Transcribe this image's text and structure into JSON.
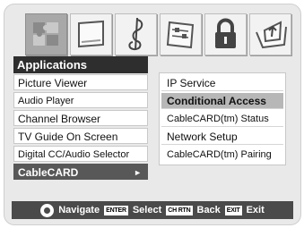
{
  "menu": {
    "title": "Applications",
    "items": [
      {
        "label": "Picture Viewer"
      },
      {
        "label": "Audio Player"
      },
      {
        "label": "Channel Browser"
      },
      {
        "label": "TV Guide On Screen"
      },
      {
        "label": "Digital CC/Audio Selector"
      },
      {
        "label": "CableCARD",
        "arrow": "►"
      }
    ]
  },
  "submenu": {
    "items": [
      {
        "label": "IP Service"
      },
      {
        "label": "Conditional Access"
      },
      {
        "label": "CableCARD(tm) Status"
      },
      {
        "label": "Network Setup"
      },
      {
        "label": "CableCARD(tm) Pairing"
      }
    ]
  },
  "tabs": [
    {
      "icon": "puzzle-icon"
    },
    {
      "icon": "display-icon"
    },
    {
      "icon": "music-note-icon"
    },
    {
      "icon": "settings-sliders-icon"
    },
    {
      "icon": "lock-icon"
    },
    {
      "icon": "install-tray-icon"
    }
  ],
  "footer": {
    "navigate_label": "Navigate",
    "enter_key": "ENTER",
    "select_label": "Select",
    "chrtn_key": "CH RTN",
    "back_label": "Back",
    "exit_key": "EXIT",
    "exit_label": "Exit"
  },
  "colors": {
    "selected_item": "#585858",
    "highlighted_subitem": "#b7b7b7",
    "title_bar": "#2e2e2e",
    "footer_bar": "#4a4a4a"
  }
}
